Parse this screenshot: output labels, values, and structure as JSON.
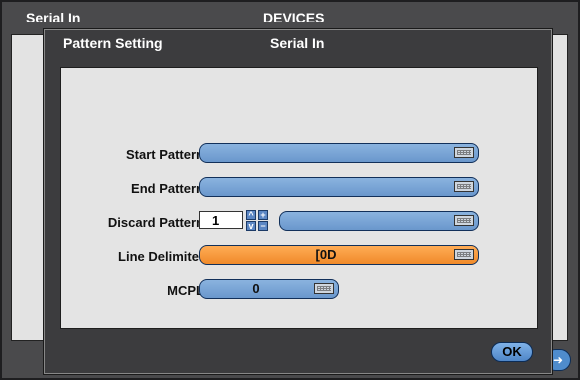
{
  "background_window": {
    "title_left": "Serial In",
    "title_center": "DEVICES",
    "next_icon": "arrow-right-icon"
  },
  "dialog": {
    "title_left": "Pattern Setting",
    "title_center": "Serial In",
    "ok_label": "OK"
  },
  "fields": {
    "start_pattern": {
      "label": "Start Pattern",
      "value": ""
    },
    "end_pattern": {
      "label": "End Pattern",
      "value": ""
    },
    "discard_pattern": {
      "label": "Discard Pattern",
      "count": "1",
      "value": ""
    },
    "line_delimiter": {
      "label": "Line Delimiter",
      "value": "[0D"
    },
    "mcpl": {
      "label": "MCPL",
      "value": "0"
    }
  },
  "icons": {
    "keyboard": "keyboard-icon",
    "spin_up": "^",
    "spin_down": "v",
    "plus": "+",
    "minus": "−"
  },
  "colors": {
    "field_blue": "#7aa7d8",
    "field_selected_orange": "#f5992f",
    "panel_bg": "#e4e4e4",
    "dialog_bg": "#3c3c3e"
  }
}
